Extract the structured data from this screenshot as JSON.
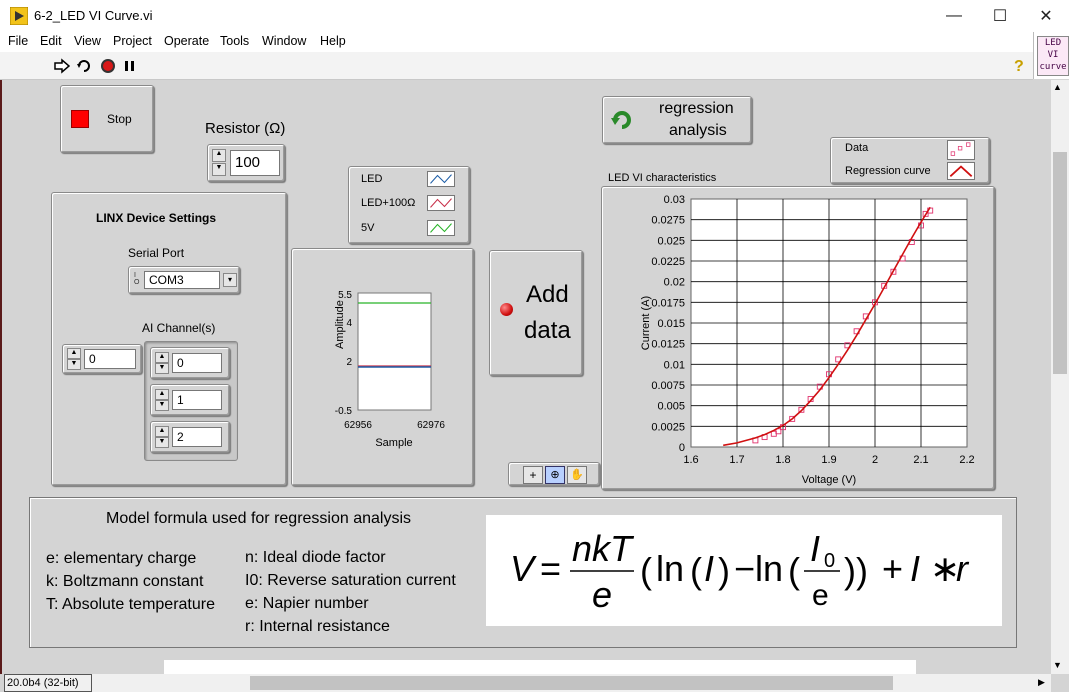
{
  "window": {
    "title": "6-2_LED VI Curve.vi",
    "minimize": "—",
    "maximize": "☐",
    "close": "✕"
  },
  "menu": [
    "File",
    "Edit",
    "View",
    "Project",
    "Operate",
    "Tools",
    "Window",
    "Help"
  ],
  "vi_icon": {
    "line1": "LED",
    "line2": "VI",
    "line3": "curve"
  },
  "controls": {
    "stop_label": "Stop",
    "resistor_label": "Resistor (Ω)",
    "resistor_value": "100",
    "regression_label_1": "regression",
    "regression_label_2": "analysis",
    "add_data_1": "Add",
    "add_data_2": "data"
  },
  "linx": {
    "title": "LINX Device Settings",
    "serial_port_label": "Serial Port",
    "serial_port_value": "COM3",
    "ai_channels_label": "AI Channel(s)",
    "array_index": "0",
    "channels": [
      "0",
      "1",
      "2"
    ]
  },
  "waveform_legend": [
    {
      "name": "LED",
      "color": "#1f5fa8"
    },
    {
      "name": "LED+100Ω",
      "color": "#c8304a"
    },
    {
      "name": "5V",
      "color": "#28b428"
    }
  ],
  "waveform_chart": {
    "ylabel": "Amplitude",
    "xlabel": "Sample",
    "yticks": [
      "5.5",
      "4",
      "2",
      "-0.5"
    ],
    "xticks": [
      "62956",
      "62976"
    ]
  },
  "xy_legend": [
    {
      "name": "Data",
      "color": "#e0306c"
    },
    {
      "name": "Regression curve",
      "color": "#d01010"
    }
  ],
  "chart_data": {
    "type": "scatter",
    "title": "LED VI characteristics",
    "xlabel": "Voltage (V)",
    "ylabel": "Current (A)",
    "xlim": [
      1.6,
      2.2
    ],
    "ylim": [
      0,
      0.03
    ],
    "xticks": [
      "1.6",
      "1.7",
      "1.8",
      "1.9",
      "2",
      "2.1",
      "2.2"
    ],
    "yticks": [
      "0",
      "0.0025",
      "0.005",
      "0.0075",
      "0.01",
      "0.0125",
      "0.015",
      "0.0175",
      "0.02",
      "0.0225",
      "0.025",
      "0.0275",
      "0.03"
    ],
    "series": [
      {
        "name": "Data",
        "kind": "scatter",
        "x": [
          1.74,
          1.76,
          1.78,
          1.79,
          1.8,
          1.82,
          1.84,
          1.86,
          1.88,
          1.9,
          1.92,
          1.94,
          1.96,
          1.98,
          2.0,
          2.02,
          2.04,
          2.06,
          2.08,
          2.1,
          2.11,
          2.12
        ],
        "y": [
          0.0008,
          0.0012,
          0.0016,
          0.0019,
          0.0024,
          0.0034,
          0.0045,
          0.0058,
          0.0073,
          0.0088,
          0.0106,
          0.0123,
          0.014,
          0.0158,
          0.0175,
          0.0195,
          0.0212,
          0.0228,
          0.0248,
          0.0268,
          0.0282,
          0.0286
        ]
      },
      {
        "name": "Regression curve",
        "kind": "line",
        "x": [
          1.67,
          1.7,
          1.72,
          1.74,
          1.76,
          1.78,
          1.8,
          1.82,
          1.84,
          1.86,
          1.88,
          1.9,
          1.92,
          1.94,
          1.96,
          1.98,
          2.0,
          2.02,
          2.04,
          2.06,
          2.08,
          2.1,
          2.12
        ],
        "y": [
          0.0002,
          0.0005,
          0.0008,
          0.0011,
          0.0015,
          0.002,
          0.0026,
          0.0034,
          0.0044,
          0.0056,
          0.0069,
          0.0084,
          0.01,
          0.0117,
          0.0135,
          0.0154,
          0.0173,
          0.0193,
          0.0213,
          0.0233,
          0.0253,
          0.0272,
          0.029
        ]
      }
    ]
  },
  "model": {
    "heading": "Model formula used for regression analysis",
    "defs_left": [
      "e: elementary charge",
      "k: Boltzmann constant",
      "T: Absolute temperature"
    ],
    "defs_right": [
      "n: Ideal diode factor",
      "I0: Reverse saturation current",
      "e: Napier number",
      "r: Internal resistance"
    ],
    "formula": "V = nkT/e (ln(I) − ln(I0/e)) + I*r"
  },
  "status": "20.0b4 (32-bit)"
}
